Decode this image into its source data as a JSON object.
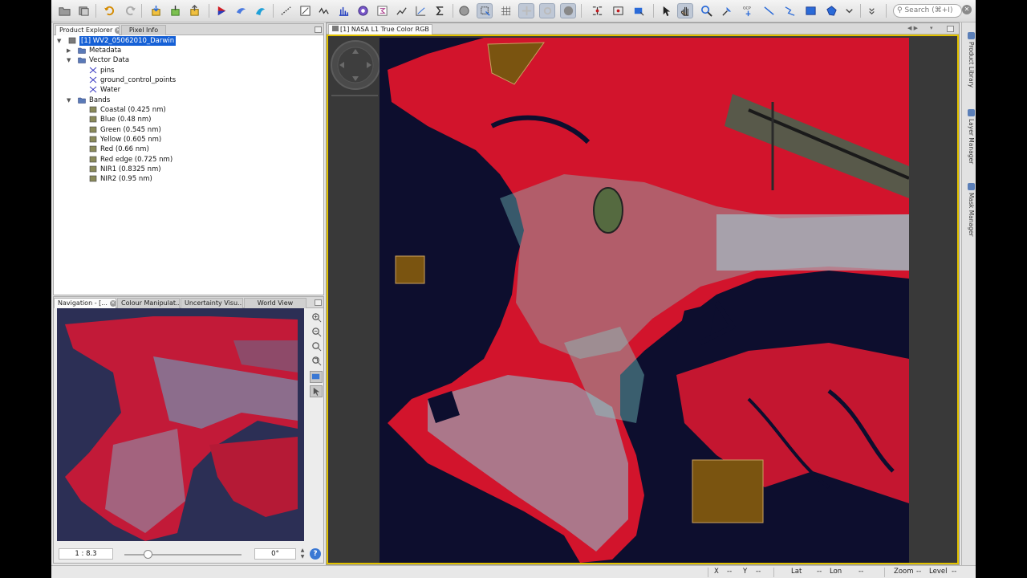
{
  "toolbar": {
    "search_placeholder": "Search (⌘+I)",
    "tools": [
      "open-product-icon",
      "session-icon",
      "undo-icon",
      "redo-icon",
      "import-icon",
      "band-maths-icon",
      "export-icon",
      "rgb-image-icon",
      "colour-icon",
      "map-icon",
      "range-finder-icon",
      "graph-icon",
      "spectrum-icon",
      "histogram-icon",
      "statistics-icon",
      "sigma-icon",
      "pixel-icon",
      "selection-icon",
      "grid-icon",
      "sync-view-icon",
      "sync-cursor-icon",
      "world-icon",
      "gcp-tools-icon",
      "mask-icon",
      "layer-icon",
      "pointer-icon",
      "pan-icon",
      "zoom-icon",
      "pin-icon",
      "gcp-icon",
      "line-icon",
      "polyline-icon",
      "rectangle-icon",
      "polygon-icon",
      "more-icon"
    ]
  },
  "product_explorer": {
    "tabs": [
      {
        "label": "Product Explorer",
        "active": true
      },
      {
        "label": "Pixel Info",
        "active": false
      }
    ],
    "tree": {
      "product": "[1] WV2_05062010_Darwin",
      "metadata": "Metadata",
      "vector_data": "Vector Data",
      "vectors": [
        "pins",
        "ground_control_points",
        "Water"
      ],
      "bands_label": "Bands",
      "bands": [
        "Coastal (0.425 nm)",
        "Blue (0.48 nm)",
        "Green (0.545 nm)",
        "Yellow (0.605 nm)",
        "Red (0.66 nm)",
        "Red edge (0.725 nm)",
        "NIR1 (0.8325 nm)",
        "NIR2 (0.95 nm)"
      ]
    }
  },
  "navigation": {
    "tabs": [
      "Navigation - [...",
      "Colour Manipulat...",
      "Uncertainty Visu...",
      "World View"
    ],
    "active_tab": "Navigation - [...",
    "scale": "1 : 8.3",
    "angle": "0°",
    "zoom_level": 0.2
  },
  "image_view": {
    "tab_label": "[1] NASA L1 True Color RGB"
  },
  "right_sidebar": [
    "Product Library",
    "Layer Manager",
    "Mask Manager"
  ],
  "status": {
    "x_label": "X",
    "x_value": "--",
    "y_label": "Y",
    "y_value": "--",
    "lat_label": "Lat",
    "lat_value": "--",
    "lon_label": "Lon",
    "lon_value": "--",
    "zoom_label": "Zoom",
    "zoom_value": "--",
    "level_label": "Level",
    "level_value": "--"
  },
  "colors": {
    "vegetation": "#d2142c",
    "water": "#0d0e2e",
    "urban": "#7fd6d0",
    "mask_fill": "#7a5410",
    "selection": "#1560d6",
    "view_border": "#e2c200"
  }
}
